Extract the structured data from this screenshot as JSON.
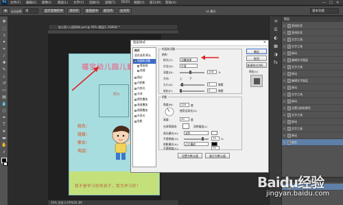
{
  "menubar": {
    "logo": "Ps",
    "items": [
      "文件(F)",
      "编辑(E)",
      "图像(I)",
      "图层(L)",
      "文字(Y)",
      "选择(S)",
      "滤镜(T)",
      "3D(D)",
      "视图(V)",
      "窗口(W)",
      "帮助(H)"
    ],
    "window_controls": [
      "—",
      "□",
      "✕"
    ]
  },
  "optbar": {
    "tool_icon": "move-tool-icon",
    "auto_select": "自动选择:",
    "auto_select_value": "组",
    "transform_controls": "显示变换控件",
    "align_buttons": [
      "顶对齐",
      "垂直居中",
      "底对齐",
      "左对齐",
      "水平居中",
      "右对齐"
    ],
    "mode_3d": "3D 模式:",
    "workspace": "基本功能"
  },
  "document": {
    "tab": "幼儿园 (入园须知).psd @ 50% (图层1, RGB/8) *",
    "status": "50%  文档:2.67M/26.3M",
    "card_title": "福宝幼儿园儿童",
    "photo_label": "照片",
    "fields": [
      "姓名：",
      "班级：",
      "家长：",
      "电话："
    ],
    "slogan": "我不是学习好的孩子，我为学习好！"
  },
  "dialog": {
    "title": "图层样式",
    "close": "✕",
    "styles_header": "样式",
    "blend_default": "混合选项:默认",
    "style_items": [
      {
        "label": "斜面和浮雕",
        "checked": true,
        "selected": true
      },
      {
        "label": "等高线",
        "checked": false,
        "selected": false
      },
      {
        "label": "纹理",
        "checked": false,
        "selected": false
      },
      {
        "label": "描边",
        "checked": false,
        "selected": false
      },
      {
        "label": "内阴影",
        "checked": false,
        "selected": false
      },
      {
        "label": "内发光",
        "checked": false,
        "selected": false
      },
      {
        "label": "光泽",
        "checked": false,
        "selected": false
      },
      {
        "label": "颜色叠加",
        "checked": false,
        "selected": false
      },
      {
        "label": "渐变叠加",
        "checked": false,
        "selected": false
      },
      {
        "label": "图案叠加",
        "checked": false,
        "selected": false
      },
      {
        "label": "外发光",
        "checked": false,
        "selected": false
      },
      {
        "label": "投影",
        "checked": false,
        "selected": false
      }
    ],
    "structure": {
      "group_title": "斜面和浮雕",
      "section": "结构",
      "style_label": "样式(T):",
      "style_value": "浮雕效果",
      "technique_label": "方法(Q):",
      "technique_value": "平滑",
      "depth_label": "深度(D):",
      "depth_value": "100",
      "depth_unit": "%",
      "direction_label": "方向:",
      "direction_up": "上",
      "direction_down": "下",
      "size_label": "大小(Z):",
      "size_value": "5",
      "size_unit": "像素",
      "soften_label": "软化(F):",
      "soften_value": "0",
      "soften_unit": "像素"
    },
    "shading": {
      "section": "阴影",
      "angle_label": "角度(N):",
      "angle_value": "120",
      "angle_unit": "度",
      "global_light": "使用全局光(G)",
      "altitude_label": "高度:",
      "altitude_value": "30",
      "altitude_unit": "度",
      "gloss_label": "光泽等高线:",
      "anti_alias": "消除锯齿(L)",
      "highlight_label": "高光模式(H):",
      "highlight_value": "滤色",
      "highlight_opacity_label": "不透明度(O):",
      "highlight_opacity": "75",
      "shadow_label": "阴影模式(A):",
      "shadow_value": "正片叠底",
      "shadow_opacity_label": "不透明度(C):",
      "shadow_opacity": "75",
      "percent": "%"
    },
    "buttons": {
      "ok": "确定",
      "cancel": "取消",
      "new_style": "新建样式(W)...",
      "preview": "预览(V)",
      "make_default": "设置为默认值",
      "reset_default": "复位为默认值"
    }
  },
  "layers": {
    "header": "图层",
    "rows": [
      "直线形状",
      "直线形状",
      "文字工具",
      "文字工具",
      "移动",
      "编辑文字图层",
      "文字工具",
      "移动",
      "编辑文字图层",
      "移动",
      "文字工具",
      "移动",
      "设置当前前景色",
      "文字工具",
      "移动",
      "文字工具",
      "移动",
      "矩形"
    ],
    "active_index": 17,
    "bottom_tabs": [
      "图层",
      "通道",
      "路径"
    ],
    "bottom_row": "幼儿园儿童素材.psd"
  },
  "watermark": {
    "text": "Baidu经验",
    "url": "jingyan.baidu.com"
  },
  "colors": {
    "card_bg": "#a8dde0",
    "card_title": "#dd7f9a",
    "field_text": "#c97a52",
    "footer": "#c3e07b",
    "annotation": "#e02020",
    "selection": "#3a6bc8"
  }
}
